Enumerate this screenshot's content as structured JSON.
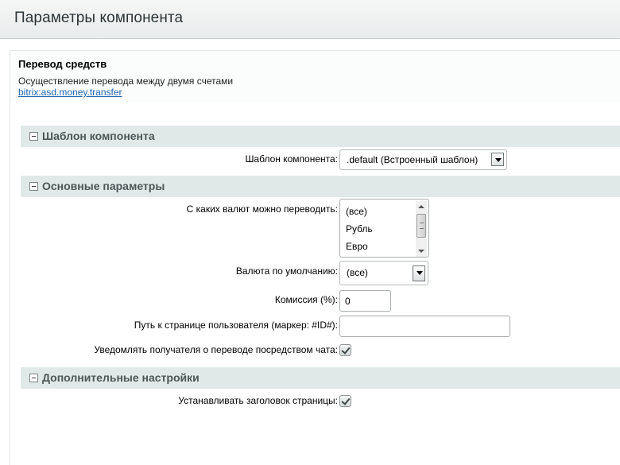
{
  "window": {
    "title": "Параметры компонента"
  },
  "component": {
    "name": "Перевод средств",
    "description": "Осуществление перевода между двумя счетами",
    "link": "bitrix:asd.money.transfer"
  },
  "sections": {
    "template": {
      "title": "Шаблон компонента",
      "template_label": "Шаблон компонента:",
      "template_value": ".default (Встроенный шаблон)"
    },
    "basic": {
      "title": "Основные параметры",
      "currencies_label": "С каких валют можно переводить:",
      "currencies_options": [
        "(все)",
        "Рубль",
        "Евро"
      ],
      "default_currency_label": "Валюта по умолчанию:",
      "default_currency_value": "(все)",
      "commission_label": "Комиссия (%):",
      "commission_value": "0",
      "user_path_label": "Путь к странице пользователя (маркер: #ID#):",
      "user_path_value": "",
      "notify_label": "Уведомлять получателя о переводе посредством чата:",
      "notify_checked": true
    },
    "extra": {
      "title": "Дополнительные настройки",
      "set_title_label": "Устанавливать заголовок страницы:",
      "set_title_checked": true
    }
  },
  "colors": {
    "section_header_bg": "#e1e8e8",
    "link": "#2067b0",
    "title_bar_bg": "#eceeee"
  }
}
